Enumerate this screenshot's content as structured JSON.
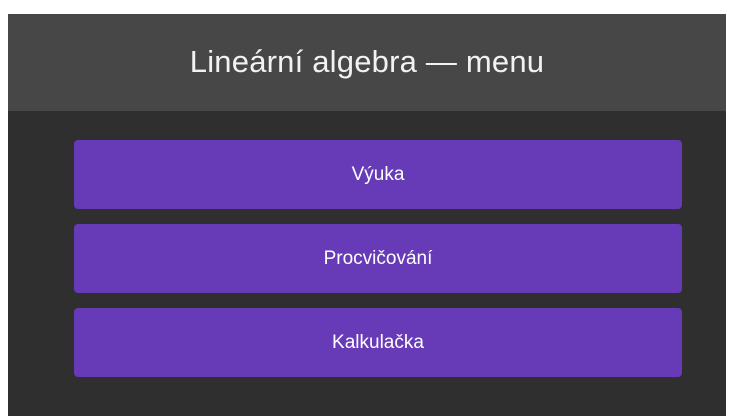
{
  "header": {
    "title": "Lineární algebra — menu"
  },
  "menu": {
    "items": [
      {
        "label": "Výuka"
      },
      {
        "label": "Procvičování"
      },
      {
        "label": "Kalkulačka"
      }
    ]
  },
  "colors": {
    "header_bg": "#474747",
    "body_bg": "#2f2f2f",
    "button_bg": "#673ab7",
    "text": "#ffffff"
  }
}
